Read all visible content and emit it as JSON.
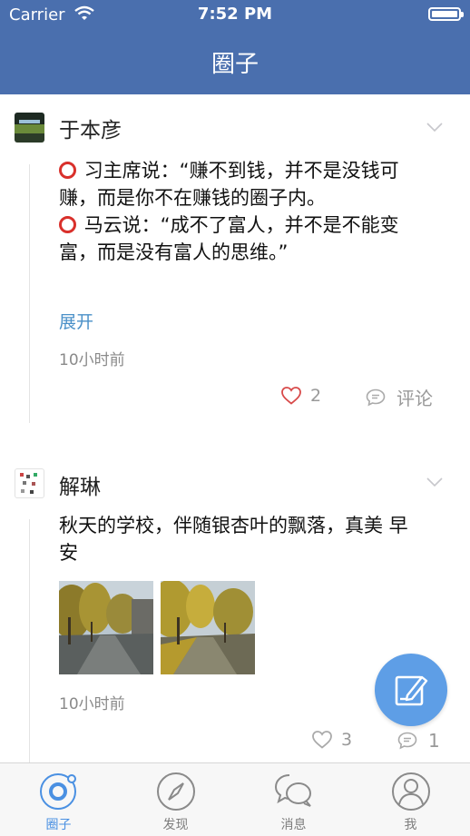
{
  "status_bar": {
    "carrier": "Carrier",
    "time": "7:52 PM"
  },
  "nav": {
    "title": "圈子"
  },
  "posts": [
    {
      "author": "于本彦",
      "lines": [
        "习主席说：“赚不到钱，并不是没钱可赚，而是你不在赚钱的圈子内。",
        "马云说：“成不了富人，并不是不能变富，而是没有富人的思维。”"
      ],
      "expand_label": "展开",
      "time": "10小时前",
      "likes": "2",
      "comment_label": "评论"
    },
    {
      "author": "解琳",
      "text": "秋天的学校，伴随银杏叶的飘落，真美  早安",
      "time": "10小时前",
      "likes": "3",
      "comments": "1"
    }
  ],
  "tabs": [
    {
      "label": "圈子",
      "icon": "circle-icon"
    },
    {
      "label": "发现",
      "icon": "compass-icon"
    },
    {
      "label": "消息",
      "icon": "chat-bubbles-icon"
    },
    {
      "label": "我",
      "icon": "user-icon"
    }
  ],
  "colors": {
    "nav_blue": "#4a6fae",
    "accent": "#4a90e2",
    "fab": "#5e9ee6",
    "emoji_red": "#d9302b"
  }
}
